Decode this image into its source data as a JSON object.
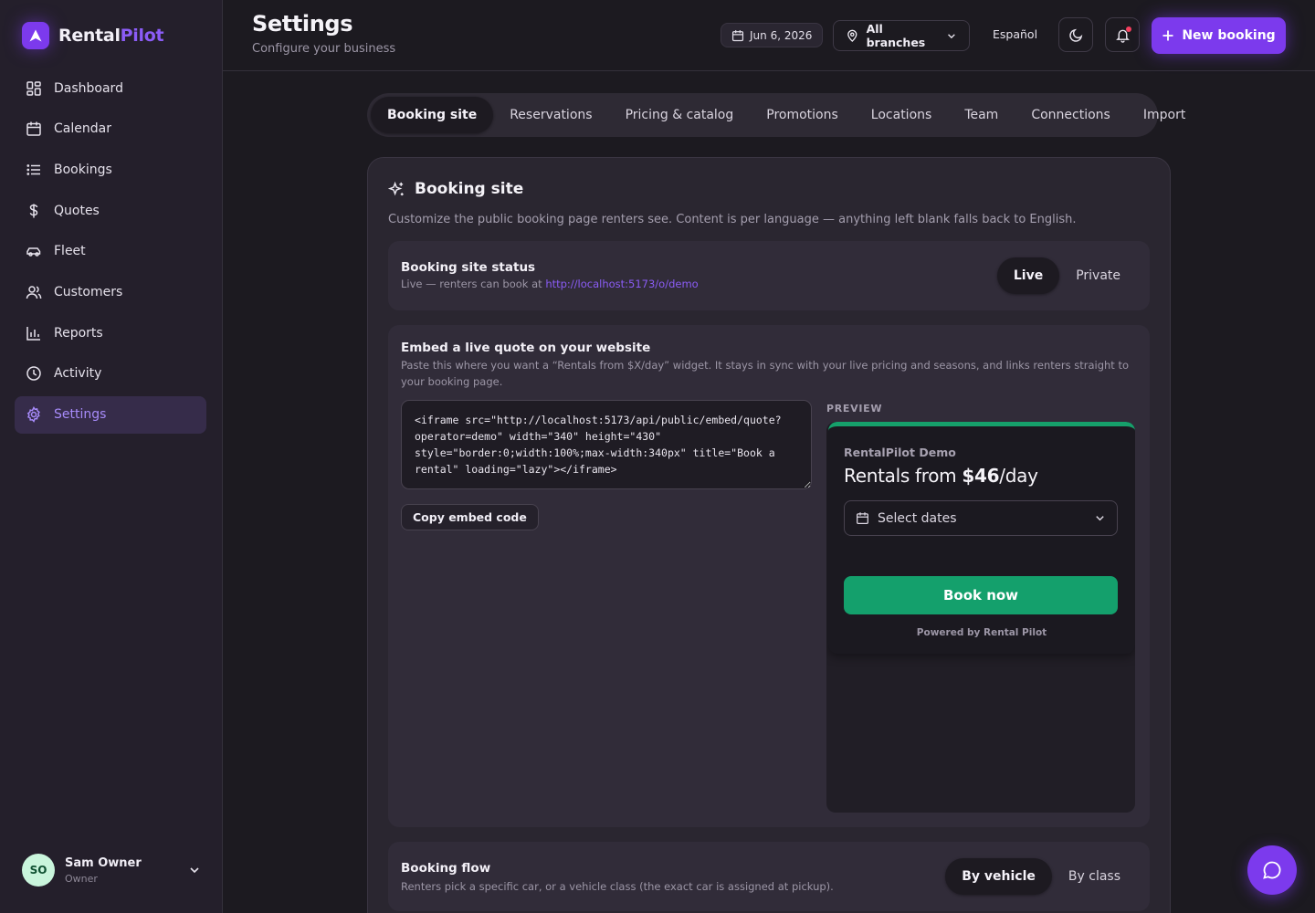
{
  "brand": {
    "name_part1": "Rental",
    "name_part2": "Pilot",
    "accent": "#7c3aed",
    "logo_icon": "logo-a-icon"
  },
  "sidebar": {
    "items": [
      {
        "label": "Dashboard",
        "icon": "dashboard-icon"
      },
      {
        "label": "Calendar",
        "icon": "calendar-icon"
      },
      {
        "label": "Bookings",
        "icon": "list-icon"
      },
      {
        "label": "Quotes",
        "icon": "dollar-icon"
      },
      {
        "label": "Fleet",
        "icon": "car-icon"
      },
      {
        "label": "Customers",
        "icon": "users-icon"
      },
      {
        "label": "Reports",
        "icon": "bar-chart-icon"
      },
      {
        "label": "Activity",
        "icon": "clock-icon"
      },
      {
        "label": "Settings",
        "icon": "gear-icon",
        "active": true
      }
    ],
    "user": {
      "initials": "SO",
      "name": "Sam Owner",
      "role": "Owner"
    }
  },
  "header": {
    "title": "Settings",
    "subtitle": "Configure your business",
    "date": "Jun 6, 2026",
    "branch": "All branches",
    "language": "Español",
    "new_booking": "New booking"
  },
  "tabs": [
    "Booking site",
    "Reservations",
    "Pricing & catalog",
    "Promotions",
    "Locations",
    "Team",
    "Connections",
    "Import"
  ],
  "active_tab": "Booking site",
  "booking_site": {
    "title": "Booking site",
    "description": "Customize the public booking page renters see. Content is per language — anything left blank falls back to English.",
    "status": {
      "title": "Booking site status",
      "desc_prefix": "Live — renters can book at ",
      "url": "http://localhost:5173/o/demo",
      "options": [
        "Live",
        "Private"
      ],
      "selected": "Live"
    },
    "embed": {
      "title": "Embed a live quote on your website",
      "desc": "Paste this where you want a “Rentals from $X/day” widget. It stays in sync with your live pricing and seasons, and links renters straight to your booking page.",
      "code": "<iframe src=\"http://localhost:5173/api/public/embed/quote?operator=demo\" width=\"340\" height=\"430\" style=\"border:0;width:100%;max-width:340px\" title=\"Book a rental\" loading=\"lazy\"></iframe>",
      "copy_label": "Copy embed code",
      "preview_label": "PREVIEW",
      "widget": {
        "operator": "RentalPilot Demo",
        "rate_prefix": "Rentals from ",
        "rate_value": "$46",
        "rate_suffix": "/day",
        "select_placeholder": "Select dates",
        "book_label": "Book now",
        "powered_by": "Powered by Rental Pilot",
        "accent": "#14a06c"
      }
    },
    "flow": {
      "title": "Booking flow",
      "desc": "Renters pick a specific car, or a vehicle class (the exact car is assigned at pickup).",
      "options": [
        "By vehicle",
        "By class"
      ],
      "selected": "By vehicle"
    }
  }
}
